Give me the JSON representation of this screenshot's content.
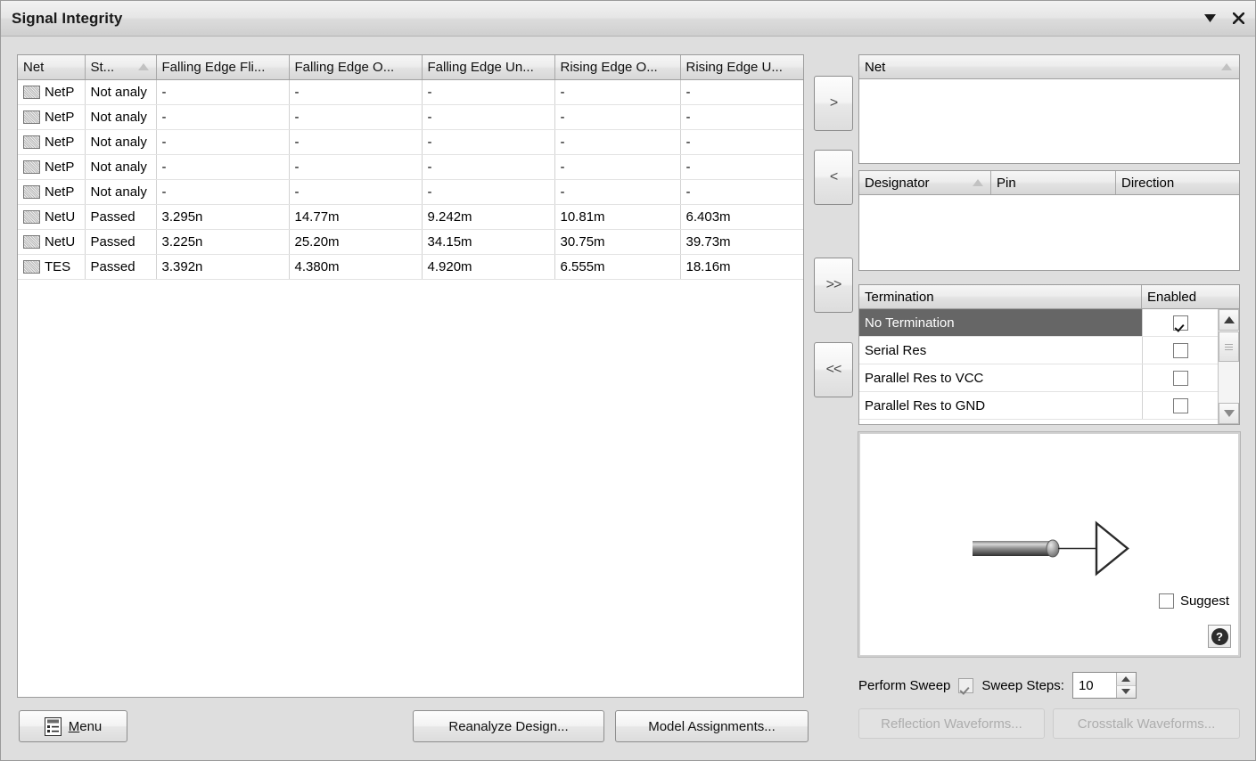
{
  "window": {
    "title": "Signal Integrity",
    "dropdown_icon": "chevron-down-icon",
    "close_icon": "close-icon"
  },
  "results_grid": {
    "columns": [
      {
        "label": "Net",
        "sorted": false
      },
      {
        "label": "St...",
        "sorted": true
      },
      {
        "label": "Falling Edge Fli...",
        "sorted": false
      },
      {
        "label": "Falling Edge O...",
        "sorted": false
      },
      {
        "label": "Falling Edge Un...",
        "sorted": false
      },
      {
        "label": "Rising Edge O...",
        "sorted": false
      },
      {
        "label": "Rising Edge U...",
        "sorted": false
      }
    ],
    "rows": [
      {
        "net": "NetP",
        "status": "Not analy",
        "falling_flight": "-",
        "falling_overshoot": "-",
        "falling_undershoot": "-",
        "rising_overshoot": "-",
        "rising_undershoot": "-"
      },
      {
        "net": "NetP",
        "status": "Not analy",
        "falling_flight": "-",
        "falling_overshoot": "-",
        "falling_undershoot": "-",
        "rising_overshoot": "-",
        "rising_undershoot": "-"
      },
      {
        "net": "NetP",
        "status": "Not analy",
        "falling_flight": "-",
        "falling_overshoot": "-",
        "falling_undershoot": "-",
        "rising_overshoot": "-",
        "rising_undershoot": "-"
      },
      {
        "net": "NetP",
        "status": "Not analy",
        "falling_flight": "-",
        "falling_overshoot": "-",
        "falling_undershoot": "-",
        "rising_overshoot": "-",
        "rising_undershoot": "-"
      },
      {
        "net": "NetP",
        "status": "Not analy",
        "falling_flight": "-",
        "falling_overshoot": "-",
        "falling_undershoot": "-",
        "rising_overshoot": "-",
        "rising_undershoot": "-"
      },
      {
        "net": "NetU",
        "status": "Passed",
        "falling_flight": "3.295n",
        "falling_overshoot": "14.77m",
        "falling_undershoot": "9.242m",
        "rising_overshoot": "10.81m",
        "rising_undershoot": "6.403m"
      },
      {
        "net": "NetU",
        "status": "Passed",
        "falling_flight": "3.225n",
        "falling_overshoot": "25.20m",
        "falling_undershoot": "34.15m",
        "rising_overshoot": "30.75m",
        "rising_undershoot": "39.73m"
      },
      {
        "net": "TES",
        "status": "Passed",
        "falling_flight": "3.392n",
        "falling_overshoot": "4.380m",
        "falling_undershoot": "4.920m",
        "rising_overshoot": "6.555m",
        "rising_undershoot": "18.16m"
      }
    ]
  },
  "transfer_buttons": [
    {
      "label": ">",
      "name": "move-right-button"
    },
    {
      "label": "<",
      "name": "move-left-button"
    },
    {
      "label": ">>",
      "name": "move-all-right-button"
    },
    {
      "label": "<<",
      "name": "move-all-left-button"
    }
  ],
  "net_list": {
    "columns": [
      {
        "label": "Net",
        "sorted": true
      }
    ],
    "rows": []
  },
  "designator_list": {
    "columns": [
      {
        "label": "Designator",
        "sorted": true
      },
      {
        "label": "Pin",
        "sorted": false
      },
      {
        "label": "Direction",
        "sorted": false
      }
    ],
    "rows": []
  },
  "termination_list": {
    "columns": [
      {
        "label": "Termination"
      },
      {
        "label": "Enabled"
      }
    ],
    "rows": [
      {
        "name": "No Termination",
        "enabled": true,
        "selected": true
      },
      {
        "name": "Serial Res",
        "enabled": false,
        "selected": false
      },
      {
        "name": "Parallel Res to VCC",
        "enabled": false,
        "selected": false
      },
      {
        "name": "Parallel Res to GND",
        "enabled": false,
        "selected": false
      }
    ],
    "scrollbar": {
      "up_icon": "chevron-up-icon",
      "down_icon": "chevron-down-icon"
    }
  },
  "preview": {
    "diagram_name": "transmission-line-to-receiver-diagram",
    "suggest_label": "Suggest",
    "suggest_checked": false,
    "help_icon": "help-icon",
    "help_glyph": "?"
  },
  "sweep": {
    "perform_sweep_label": "Perform Sweep",
    "perform_sweep_checked": true,
    "sweep_steps_label": "Sweep Steps:",
    "sweep_steps_value": "10",
    "spin_up_icon": "spinner-up-icon",
    "spin_down_icon": "spinner-down-icon"
  },
  "footer": {
    "menu_icon": "menu-list-icon",
    "menu_accel": "M",
    "menu_label_rest": "enu",
    "reanalyze_label": "Reanalyze Design...",
    "model_assignments_label": "Model Assignments...",
    "reflection_waveforms_label": "Reflection Waveforms...",
    "reflection_waveforms_disabled": true,
    "crosstalk_waveforms_label": "Crosstalk Waveforms...",
    "crosstalk_waveforms_disabled": true
  },
  "colors": {
    "panel_bg": "#dedede",
    "selection": "#666666",
    "grid_bg": "#ffffff",
    "header_grad_top": "#f6f6f6",
    "header_grad_bottom": "#d7d7d7"
  }
}
